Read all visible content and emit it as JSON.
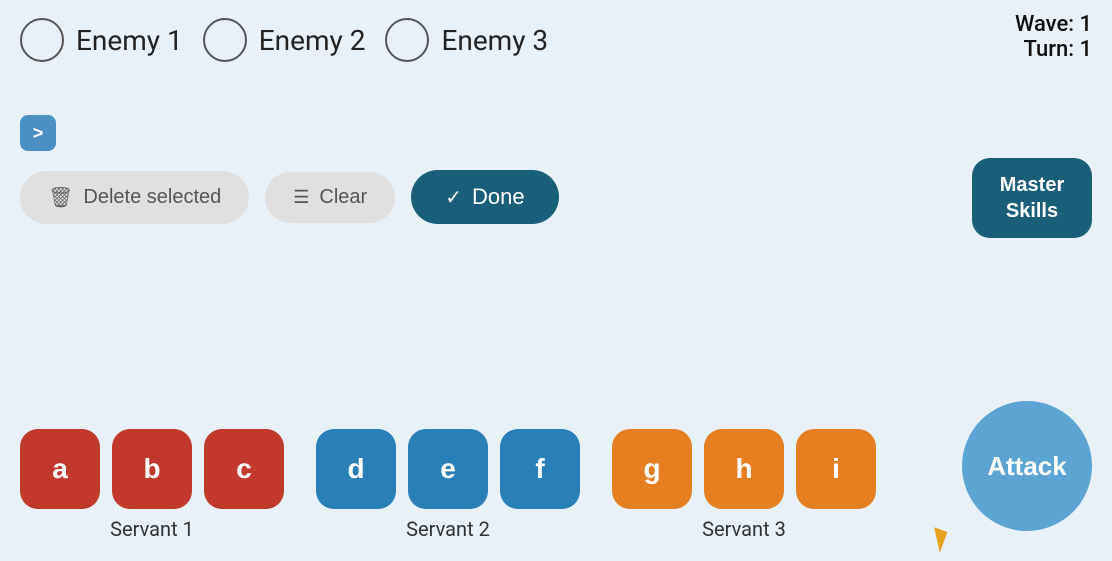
{
  "header": {
    "wave_label": "Wave: 1",
    "turn_label": "Turn: 1"
  },
  "enemies": [
    {
      "id": "enemy-1",
      "label": "Enemy 1"
    },
    {
      "id": "enemy-2",
      "label": "Enemy 2"
    },
    {
      "id": "enemy-3",
      "label": "Enemy 3"
    }
  ],
  "expand_button": {
    "icon": ">",
    "aria_label": "Expand"
  },
  "actions": {
    "delete_label": "Delete selected",
    "clear_label": "Clear",
    "done_label": "Done"
  },
  "master_skills": {
    "label": "Master\nSkills"
  },
  "servants": [
    {
      "group_label": "Servant 1",
      "color": "red",
      "buttons": [
        {
          "label": "a"
        },
        {
          "label": "b"
        },
        {
          "label": "c"
        }
      ]
    },
    {
      "group_label": "Servant 2",
      "color": "blue",
      "buttons": [
        {
          "label": "d"
        },
        {
          "label": "e"
        },
        {
          "label": "f"
        }
      ]
    },
    {
      "group_label": "Servant 3",
      "color": "orange",
      "buttons": [
        {
          "label": "g"
        },
        {
          "label": "h"
        },
        {
          "label": "i"
        }
      ]
    }
  ],
  "attack_button": {
    "label": "Attack"
  }
}
